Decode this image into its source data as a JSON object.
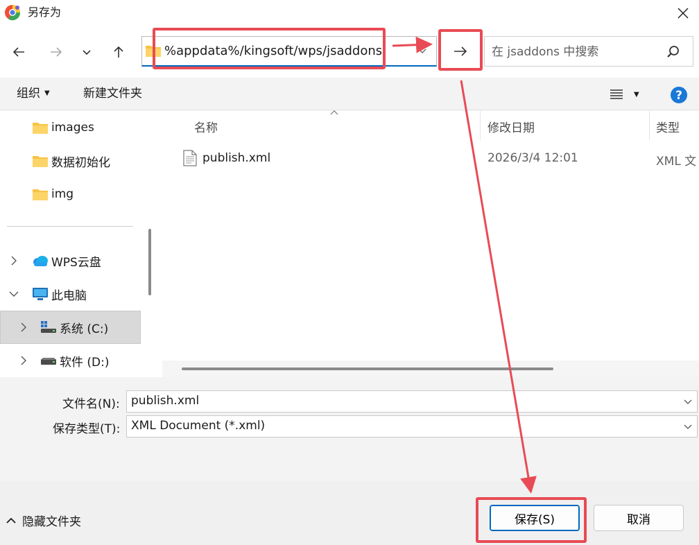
{
  "window": {
    "title": "另存为",
    "close_icon": "close-icon"
  },
  "nav": {
    "back_icon": "back-arrow-icon",
    "forward_icon": "forward-arrow-icon",
    "recent_icon": "chevron-down-icon",
    "up_icon": "up-arrow-icon",
    "address": "%appdata%/kingsoft/wps/jsaddons",
    "go_icon": "go-arrow-icon",
    "search_placeholder": "在 jsaddons 中搜索"
  },
  "toolbar": {
    "organize_label": "组织",
    "new_folder_label": "新建文件夹",
    "view_icon": "view-list-icon",
    "help_icon": "help-icon"
  },
  "sidebar": {
    "items": [
      {
        "label": "images",
        "icon": "folder-icon"
      },
      {
        "label": "数据初始化",
        "icon": "folder-icon"
      },
      {
        "label": "img",
        "icon": "folder-icon"
      },
      {
        "label": "WPS云盘",
        "icon": "cloud-icon"
      },
      {
        "label": "此电脑",
        "icon": "computer-icon"
      },
      {
        "label": "系统 (C:)",
        "icon": "system-drive-icon"
      },
      {
        "label": "软件 (D:)",
        "icon": "drive-icon"
      }
    ]
  },
  "file_list": {
    "columns": [
      "名称",
      "修改日期",
      "类型"
    ],
    "rows": [
      {
        "name": "publish.xml",
        "modified": "2026/3/4 12:01",
        "type": "XML 文"
      }
    ]
  },
  "form": {
    "filename_label": "文件名(N):",
    "filename_value": "publish.xml",
    "filetype_label": "保存类型(T):",
    "filetype_value": "XML Document (*.xml)"
  },
  "footer": {
    "hide_folders_label": "隐藏文件夹",
    "save_label": "保存(S)",
    "cancel_label": "取消"
  },
  "colors": {
    "accent": "#0067c0",
    "annotation": "#e84b55",
    "folder": "#f6c343",
    "selected": "#d9d9d9"
  }
}
